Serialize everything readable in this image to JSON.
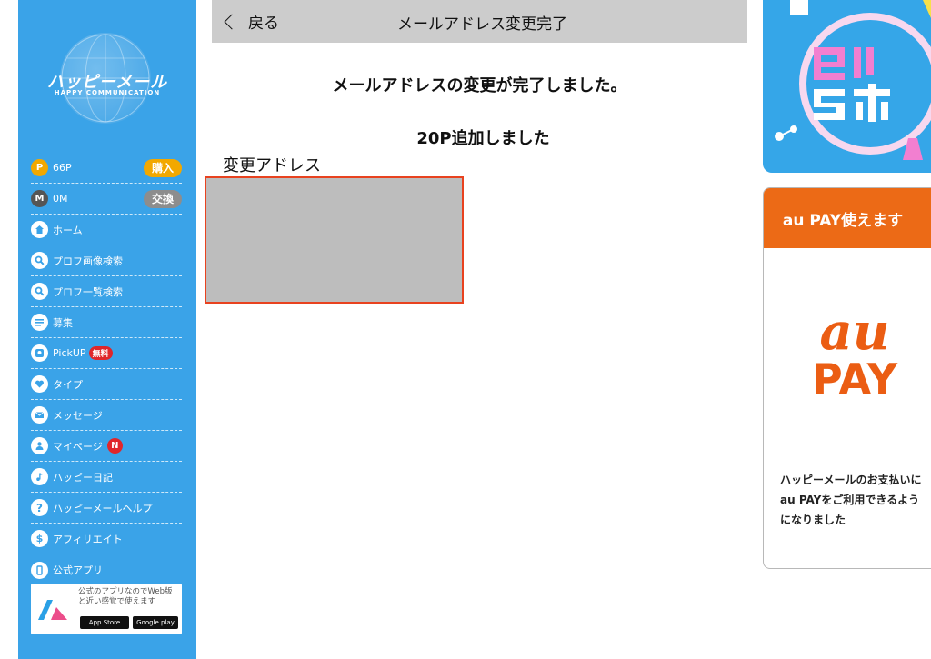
{
  "sidebar": {
    "logo_text": "ハッピーメール",
    "logo_sub": "HAPPY COMMUNICATION",
    "points": {
      "icon": "P",
      "value": "66P",
      "button": "購入"
    },
    "miles": {
      "icon": "M",
      "value": "0M",
      "button": "交換"
    },
    "items": [
      {
        "label": "ホーム",
        "icon": "home-icon"
      },
      {
        "label": "プロフ画像検索",
        "icon": "search-icon"
      },
      {
        "label": "プロフ一覧検索",
        "icon": "search-icon"
      },
      {
        "label": "募集",
        "icon": "list-icon"
      },
      {
        "label": "PickUP",
        "icon": "pickup-icon",
        "badge": "無料"
      },
      {
        "label": "タイプ",
        "icon": "heart-icon"
      },
      {
        "label": "メッセージ",
        "icon": "mail-icon"
      },
      {
        "label": "マイページ",
        "icon": "person-icon",
        "badge": "N"
      },
      {
        "label": "ハッピー日記",
        "icon": "music-note-icon"
      },
      {
        "label": "ハッピーメールヘルプ",
        "icon": "help-icon"
      },
      {
        "label": "アフィリエイト",
        "icon": "dollar-icon"
      },
      {
        "label": "公式アプリ",
        "icon": "phone-icon"
      }
    ],
    "app_promo": {
      "text": "公式のアプリなのでWeb版と近い感覚で使えます",
      "app_store": "App Store",
      "google_play": "Google play"
    }
  },
  "header": {
    "back_label": "戻る",
    "title": "メールアドレス変更完了"
  },
  "main": {
    "message": "メールアドレスの変更が完了しました。",
    "points_added": "20P追加しました",
    "address_label": "変更アドレス"
  },
  "right": {
    "banner1_text": "コラボ",
    "banner2_title": "au PAY使えます",
    "au_logo_top": "au",
    "au_logo_bottom": "PAY",
    "banner2_text": "ハッピーメールのお支払いにau PAYをご利用できるようになりました"
  },
  "colors": {
    "sidebar": "#3aa3e8",
    "accent_orange": "#f2a800",
    "au_orange": "#ec6a16",
    "highlight_red": "#e8421f"
  }
}
